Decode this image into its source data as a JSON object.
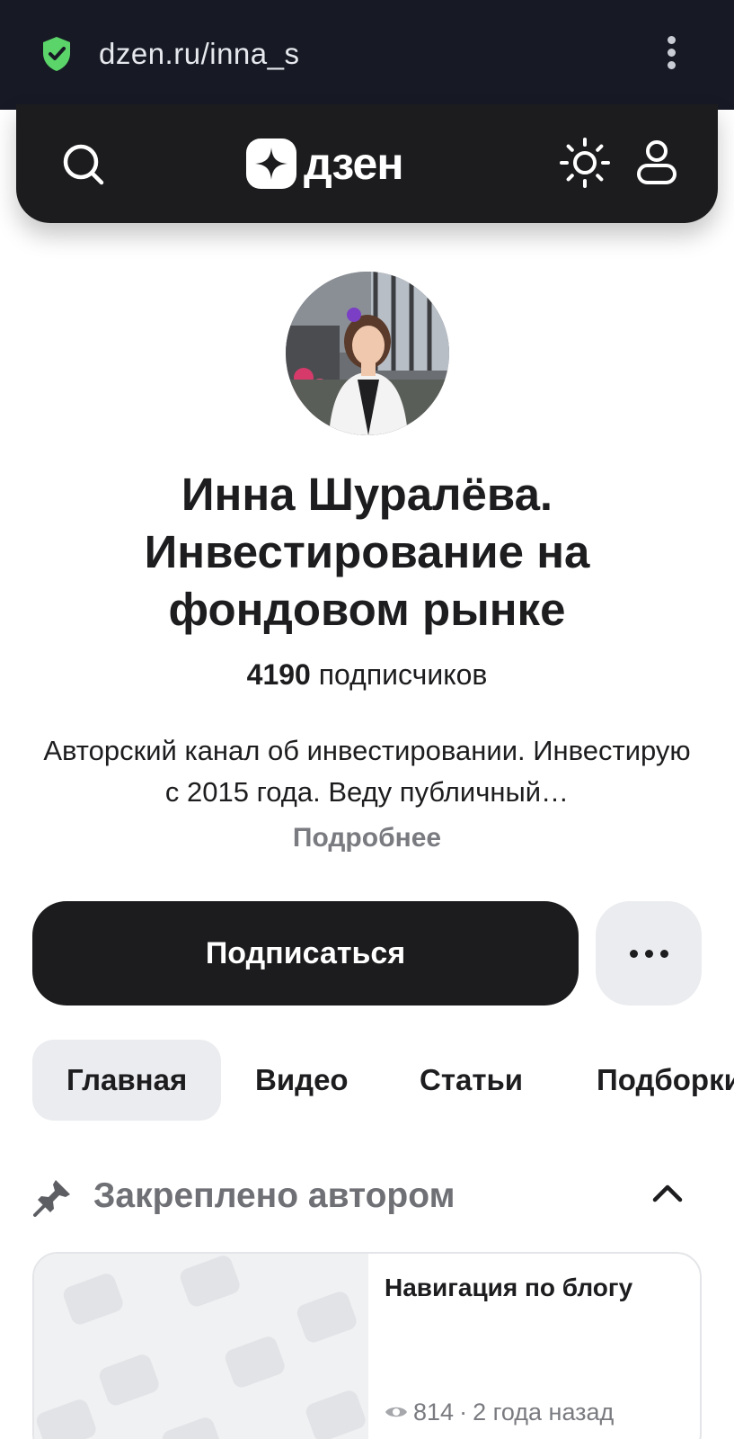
{
  "browser": {
    "url": "dzen.ru/inna_s",
    "icons": {
      "secure": "shield-check-icon",
      "menu": "kebab-icon"
    }
  },
  "header": {
    "logo_text": "дзен",
    "icons": {
      "search": "search-icon",
      "theme": "sun-icon",
      "profile": "user-icon"
    }
  },
  "channel": {
    "title": "Инна Шуралёва. Инвестирование на фондовом рынке",
    "subscribers_count": "4190",
    "subscribers_label": "подписчиков",
    "description": "Авторский канал об инвестировании. Инвестирую с 2015 года. Веду публичный…",
    "more_label": "Подробнее"
  },
  "actions": {
    "subscribe_label": "Подписаться",
    "more_icon": "ellipsis-icon"
  },
  "tabs": [
    {
      "label": "Главная",
      "active": true
    },
    {
      "label": "Видео",
      "active": false
    },
    {
      "label": "Статьи",
      "active": false
    },
    {
      "label": "Подборки",
      "active": false
    }
  ],
  "pinned": {
    "title": "Закреплено автором",
    "icons": {
      "pin": "pin-icon",
      "collapse": "chevron-up-icon"
    },
    "card": {
      "title": "Навигация по блогу",
      "views": "814",
      "separator": "·",
      "time_ago": "2 года назад"
    }
  },
  "colors": {
    "browser_bar": "#171a24",
    "header_bg": "#1c1c1e",
    "primary_button": "#1c1c1e",
    "secondary_bg": "#ebecef",
    "shield": "#4cd964",
    "muted_text": "#7a7b80"
  }
}
